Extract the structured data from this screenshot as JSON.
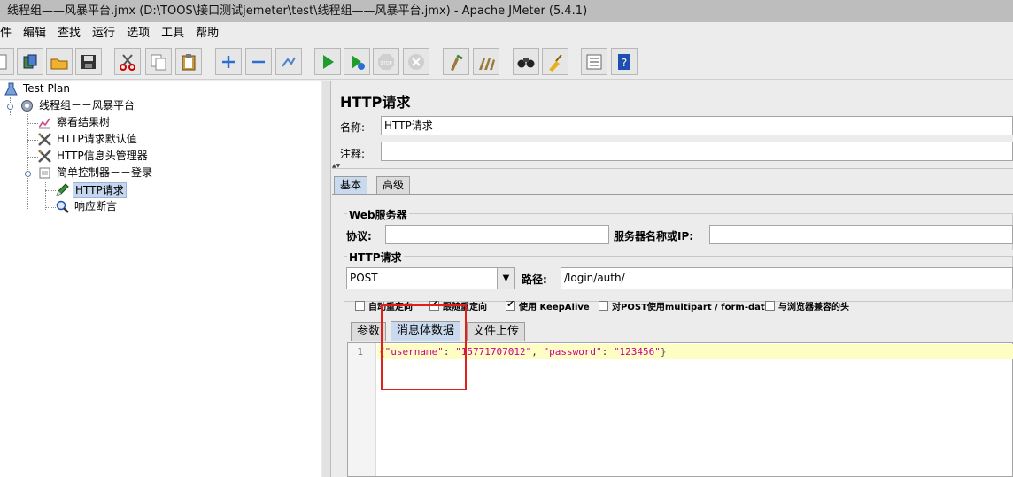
{
  "window": {
    "title": "线程组——风暴平台.jmx (D:\\TOOS\\接口测试jemeter\\test\\线程组——风暴平台.jmx) - Apache JMeter (5.4.1)"
  },
  "menu": {
    "items": [
      "件",
      "编辑",
      "查找",
      "运行",
      "选项",
      "工具",
      "帮助"
    ]
  },
  "toolbar": {
    "buttons": [
      "new-icon",
      "templates-icon",
      "open-icon",
      "save-icon",
      "cut-icon",
      "copy-icon",
      "paste-icon",
      "expand-icon",
      "collapse-icon",
      "toggle-icon",
      "start-icon",
      "start-no-timers-icon",
      "stop-icon",
      "shutdown-icon",
      "clear-icon",
      "clear-all-icon",
      "search-icon",
      "reset-search-icon",
      "function-helper-icon",
      "help-icon"
    ]
  },
  "tree": {
    "nodes": [
      {
        "label": "Test Plan",
        "icon": "test-plan-icon"
      },
      {
        "label": "线程组－－风暴平台",
        "icon": "thread-group-gear-icon"
      },
      {
        "label": "察看结果树",
        "icon": "chart-listener-icon"
      },
      {
        "label": "HTTP请求默认值",
        "icon": "config-tools-icon"
      },
      {
        "label": "HTTP信息头管理器",
        "icon": "config-tools-icon"
      },
      {
        "label": "简单控制器－－登录",
        "icon": "controller-icon"
      },
      {
        "label": "HTTP请求",
        "icon": "sampler-pen-icon",
        "selected": true
      },
      {
        "label": "响应断言",
        "icon": "assertion-magnifier-icon"
      }
    ]
  },
  "panel": {
    "title": "HTTP请求",
    "name_label": "名称:",
    "name_value": "HTTP请求",
    "comment_label": "注释:",
    "comment_value": "",
    "tabs": [
      "基本",
      "高级"
    ],
    "active_tab": "基本",
    "web_server": {
      "group_title": "Web服务器",
      "protocol_label": "协议:",
      "protocol_value": "",
      "server_label": "服务器名称或IP:",
      "server_value": ""
    },
    "http_request": {
      "group_title": "HTTP请求",
      "method": "POST",
      "path_label": "路径:",
      "path_value": "/login/auth/"
    },
    "checkboxes": [
      {
        "label": "自动重定向",
        "checked": false
      },
      {
        "label": "跟随重定向",
        "checked": true
      },
      {
        "label": "使用 KeepAlive",
        "checked": true
      },
      {
        "label": "对POST使用multipart / form-data",
        "checked": false
      },
      {
        "label": "与浏览器兼容的头",
        "checked": false
      }
    ],
    "body_tabs": [
      "参数",
      "消息体数据",
      "文件上传"
    ],
    "active_body_tab": "消息体数据",
    "editor": {
      "line_number": "1",
      "code": "{\"username\": \"15771707012\", \"password\": \"123456\"}",
      "tokens": [
        {
          "text": "{",
          "kind": "brace"
        },
        {
          "text": "\"username\"",
          "kind": "key"
        },
        {
          "text": ": ",
          "kind": "punct"
        },
        {
          "text": "\"15771707012\"",
          "kind": "key"
        },
        {
          "text": ", ",
          "kind": "punct"
        },
        {
          "text": "\"password\"",
          "kind": "key"
        },
        {
          "text": ": ",
          "kind": "punct"
        },
        {
          "text": "\"123456\"",
          "kind": "key"
        },
        {
          "text": "}",
          "kind": "brace"
        }
      ]
    }
  },
  "colors": {
    "highlight_box": "#e0211b",
    "selected_tree_bg": "#c4d7ee",
    "active_tab_bg": "#c9d9ee",
    "editor_line_bg": "#fefdc4",
    "json_string": "#c60096"
  }
}
